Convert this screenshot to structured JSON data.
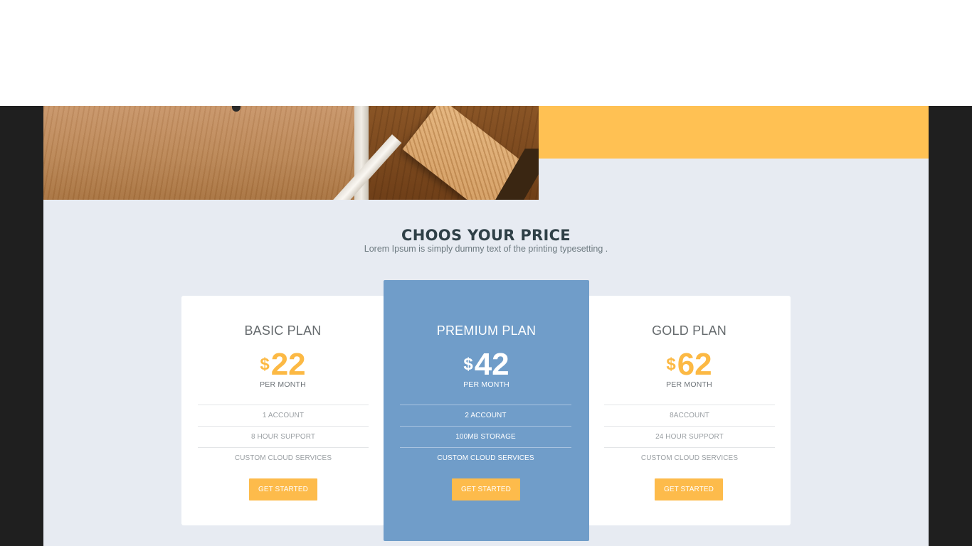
{
  "section": {
    "title": "CHOOS YOUR PRICE",
    "subtitle": "Lorem Ipsum is simply dummy text of the printing typesetting ."
  },
  "colors": {
    "accent": "#ffc153",
    "price_yellow": "#fcb944",
    "premium_blue": "#709dc9",
    "background": "#e7ebf2",
    "dark_side": "#1f1f1f"
  },
  "plans": [
    {
      "name": "BASIC PLAN",
      "currency": "$",
      "price": "22",
      "period": "PER MONTH",
      "features": [
        "1 ACCOUNT",
        "8 HOUR SUPPORT",
        "CUSTOM CLOUD SERVICES"
      ],
      "button": "GET STARTED"
    },
    {
      "name": "PREMIUM PLAN",
      "currency": "$",
      "price": "42",
      "period": "PER MONTH",
      "features": [
        "2 ACCOUNT",
        "100MB STORAGE",
        "CUSTOM CLOUD SERVICES"
      ],
      "button": "GET STARTED"
    },
    {
      "name": "GOLD PLAN",
      "currency": "$",
      "price": "62",
      "period": "PER MONTH",
      "features": [
        "8ACCOUNT",
        "24 HOUR SUPPORT",
        "CUSTOM CLOUD SERVICES"
      ],
      "button": "GET STARTED"
    }
  ]
}
